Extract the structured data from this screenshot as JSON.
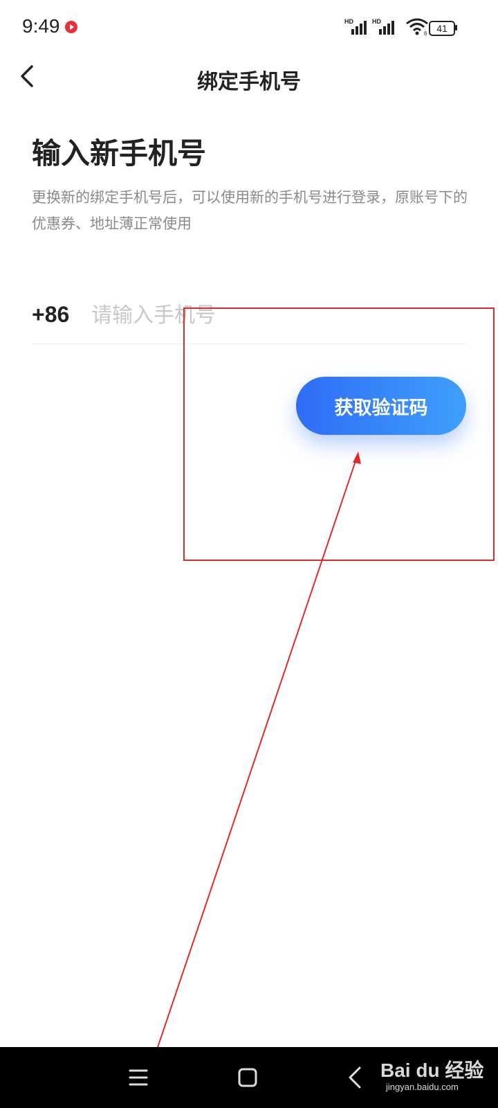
{
  "status_bar": {
    "time": "9:49",
    "signal_1_label": "HD",
    "signal_2_label": "HD",
    "wifi_label": "6",
    "battery_level": "41"
  },
  "header": {
    "title": "绑定手机号"
  },
  "main": {
    "heading": "输入新手机号",
    "description": "更换新的绑定手机号后，可以使用新的手机号进行登录，原账号下的优惠券、地址薄正常使用",
    "country_code": "+86",
    "phone_placeholder": "请输入手机号",
    "phone_value": "",
    "get_code_label": "获取验证码"
  },
  "watermark": {
    "brand": "Bai du 经验",
    "url": "jingyan.baidu.com"
  },
  "colors": {
    "accent_start": "#2f6cf6",
    "accent_end": "#3ea0fb",
    "annotation": "#e02a2a"
  }
}
